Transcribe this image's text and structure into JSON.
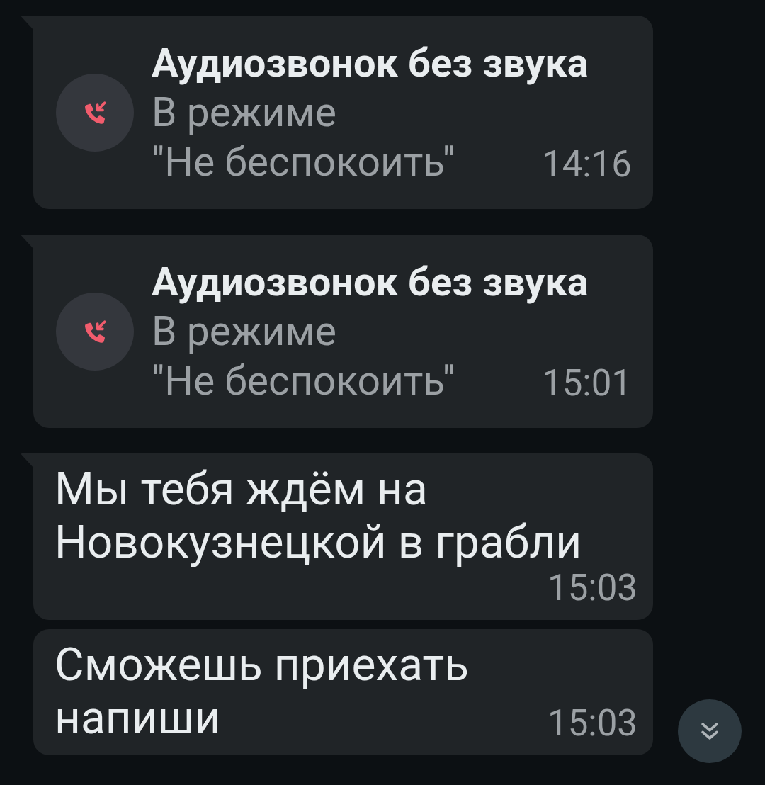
{
  "messages": [
    {
      "kind": "call",
      "tail": true,
      "title": "Аудиозвонок без звука",
      "subtitle": "В режиме\n\"Не беспокоить\"",
      "time": "14:16"
    },
    {
      "kind": "call",
      "tail": true,
      "title": "Аудиозвонок без звука",
      "subtitle": "В режиме\n\"Не беспокоить\"",
      "time": "15:01"
    },
    {
      "kind": "text",
      "tail": true,
      "text": "Мы тебя ждём на\nНовокузнецкой в грабли",
      "time": "15:03"
    },
    {
      "kind": "text",
      "tail": false,
      "text": "Сможешь приехать\nнапиши",
      "time": "15:03"
    }
  ]
}
